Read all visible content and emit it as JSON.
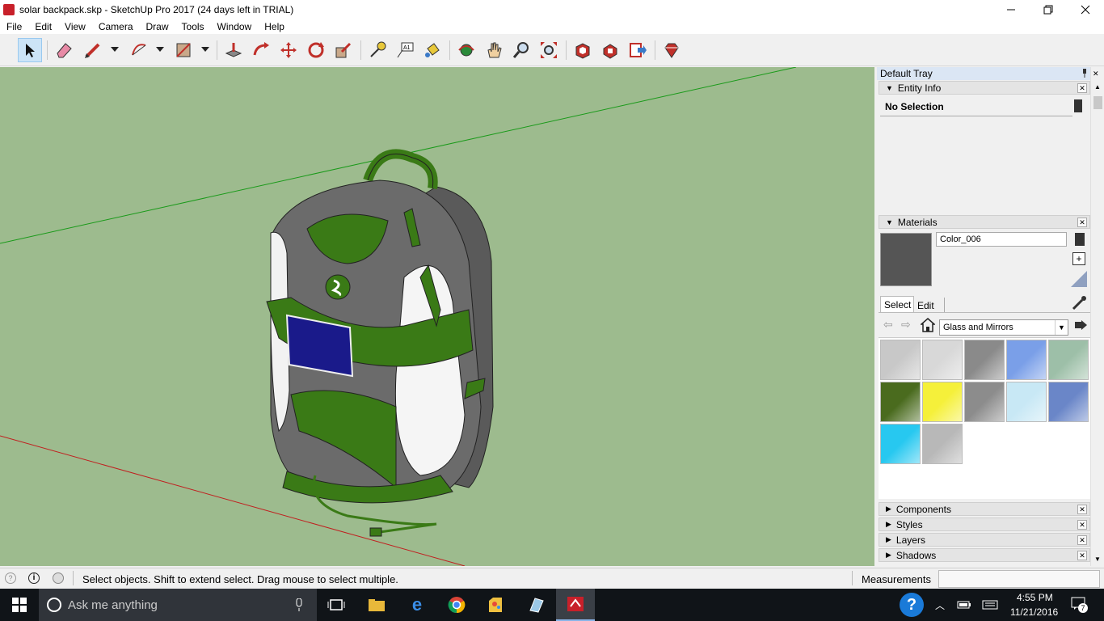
{
  "window": {
    "title": "solar backpack.skp - SketchUp Pro 2017 (24 days left in TRIAL)",
    "minimize_icon": "minimize-icon",
    "maximize_icon": "restore-icon",
    "close_icon": "close-icon"
  },
  "menu": [
    "File",
    "Edit",
    "View",
    "Camera",
    "Draw",
    "Tools",
    "Window",
    "Help"
  ],
  "toolbar": {
    "tools": [
      "select-tool",
      "eraser-tool",
      "line-tool",
      "arc-tool",
      "rectangle-tool",
      "push-pull-tool",
      "offset-tool",
      "move-tool",
      "rotate-tool",
      "scale-tool",
      "tape-measure-tool",
      "text-tool",
      "paint-bucket-tool",
      "orbit-tool",
      "pan-tool",
      "zoom-tool",
      "zoom-extents-tool",
      "3d-warehouse-tool",
      "extension-warehouse-tool",
      "send-to-layout-tool",
      "ruby-console-tool"
    ],
    "text_tool_label": "A1"
  },
  "tray": {
    "title": "Default Tray",
    "entity_info": {
      "header": "Entity Info",
      "selection": "No Selection"
    },
    "materials": {
      "header": "Materials",
      "material_name": "Color_006",
      "preview_color": "#555555",
      "tabs": [
        "Select",
        "Edit"
      ],
      "library": "Glass and Mirrors",
      "swatches": [
        {
          "name": "glass-swatch-1",
          "color": "#c8c8c8"
        },
        {
          "name": "glass-swatch-2",
          "color": "#d8d8d8"
        },
        {
          "name": "glass-swatch-3",
          "color": "#8a8a8a"
        },
        {
          "name": "glass-swatch-4",
          "color": "#7a9fe8"
        },
        {
          "name": "glass-swatch-5",
          "color": "#9dbfa8"
        },
        {
          "name": "glass-swatch-6",
          "color": "#4a6b1e"
        },
        {
          "name": "glass-swatch-7",
          "color": "#f5f03a"
        },
        {
          "name": "glass-swatch-8",
          "color": "#8c8c8c"
        },
        {
          "name": "glass-swatch-9",
          "color": "#c8e8f5"
        },
        {
          "name": "glass-swatch-10",
          "color": "#6a86c8"
        },
        {
          "name": "glass-swatch-11",
          "color": "#27c8f0"
        },
        {
          "name": "glass-swatch-12",
          "color": "#b8b8b8"
        }
      ]
    },
    "collapsed_panels": [
      "Components",
      "Styles",
      "Layers",
      "Shadows"
    ]
  },
  "status": {
    "message": "Select objects. Shift to extend select. Drag mouse to select multiple.",
    "measurements_label": "Measurements",
    "measurements_value": ""
  },
  "taskbar": {
    "search_placeholder": "Ask me anything",
    "time": "4:55 PM",
    "date": "11/21/2016",
    "notification_count": "7"
  },
  "colors": {
    "viewport_bg": "#9dbb8e",
    "backpack_gray": "#6b6b6b",
    "backpack_green": "#3a7a16",
    "solar_panel": "#1a1a8a"
  }
}
